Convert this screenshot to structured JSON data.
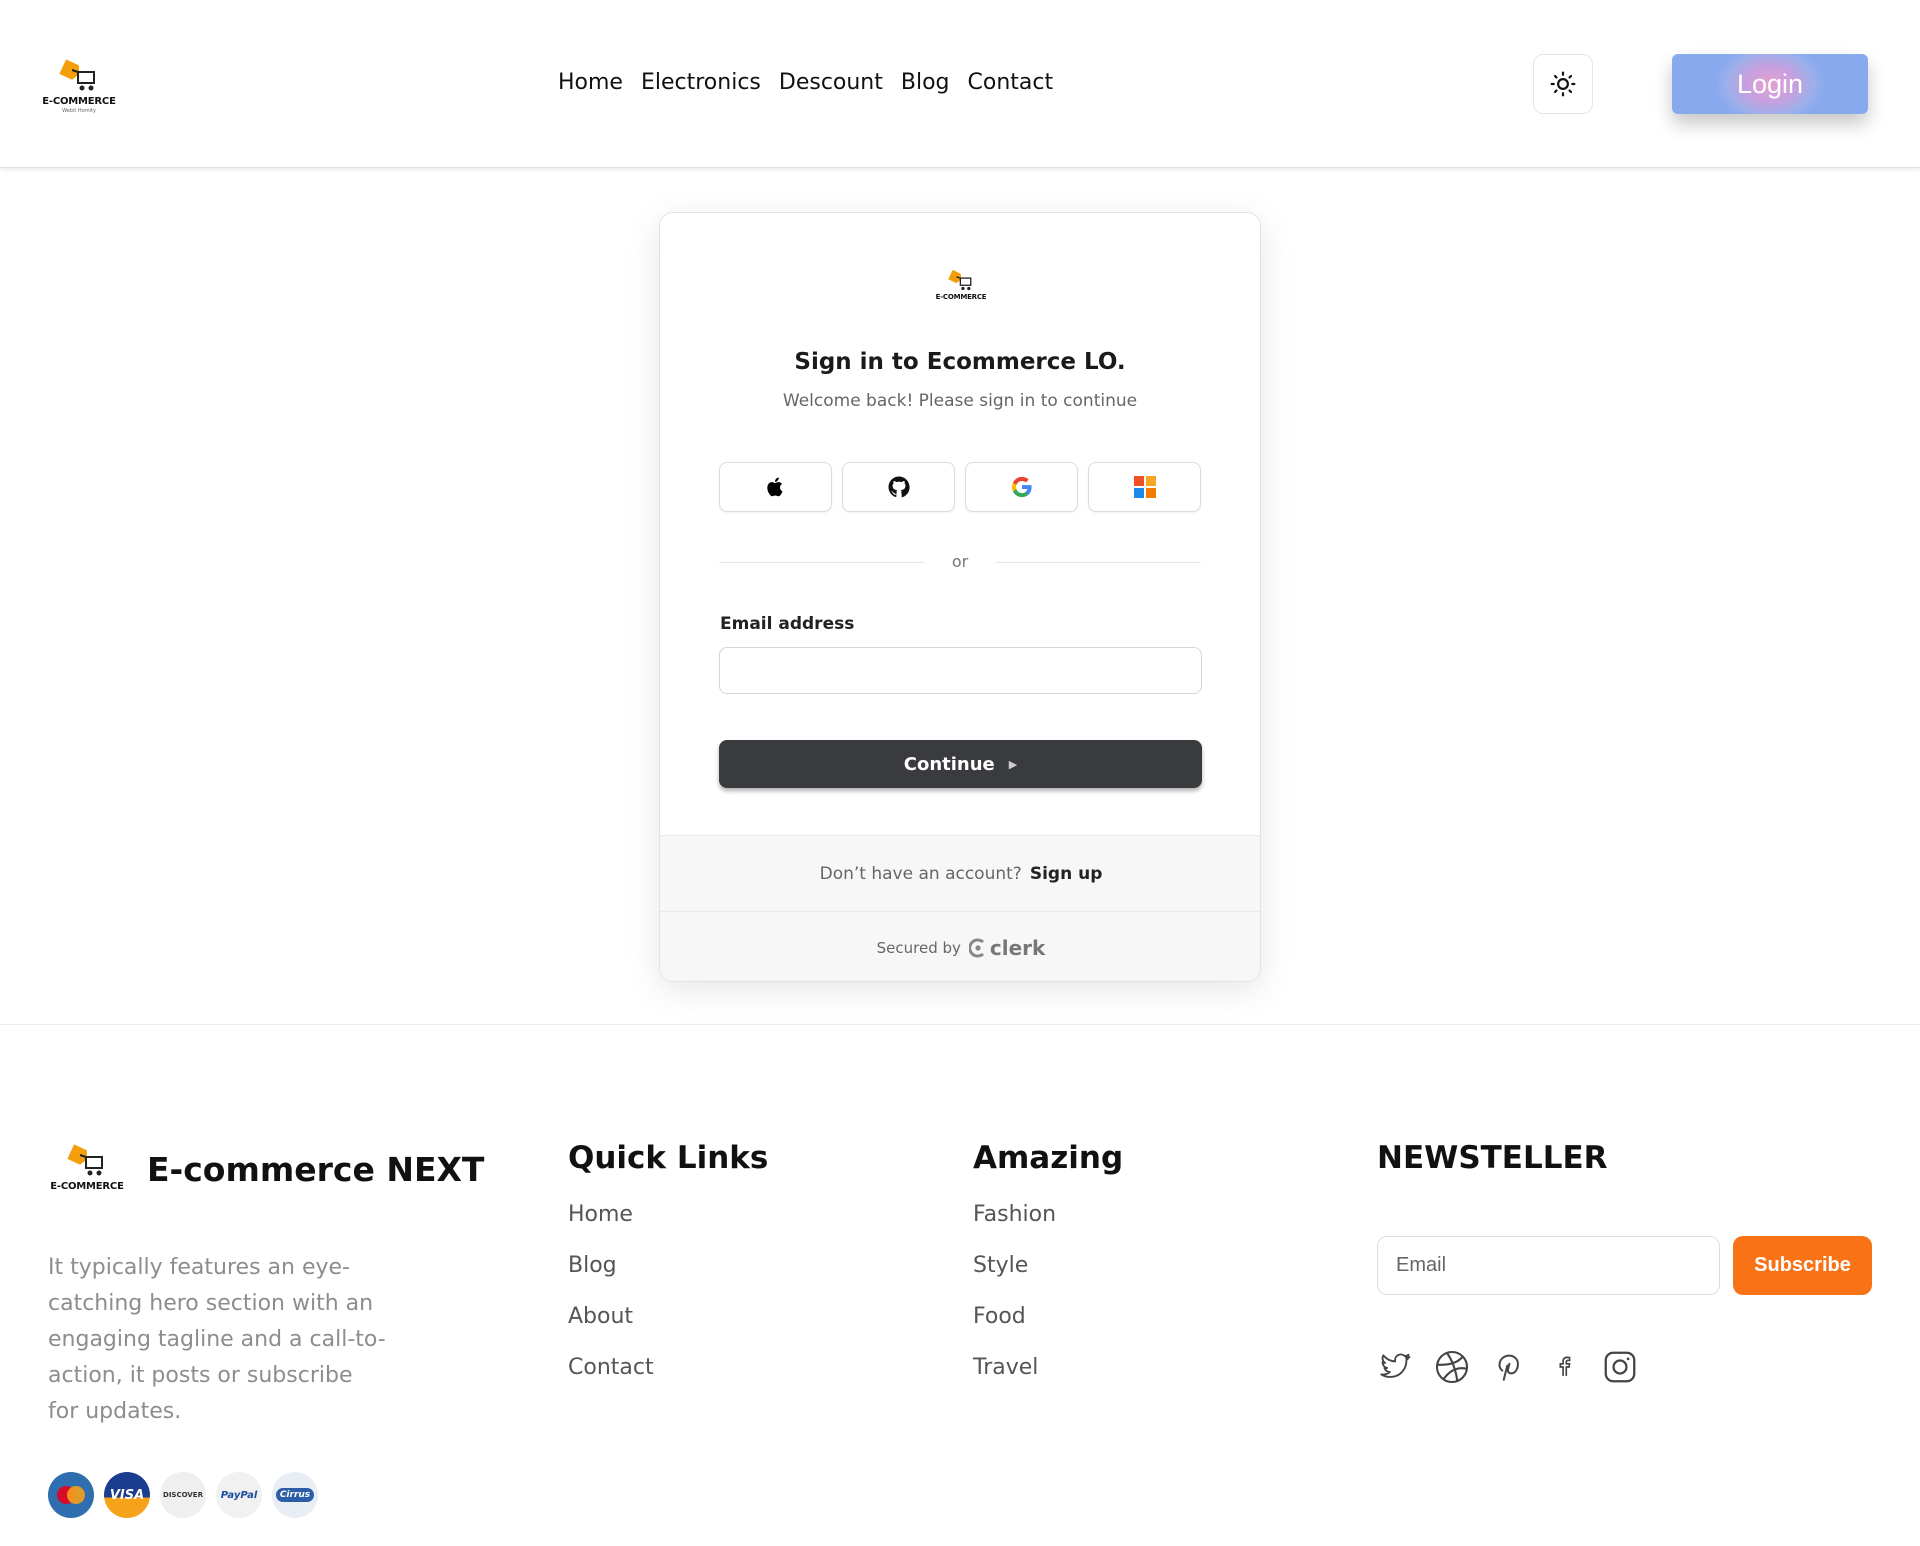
{
  "header": {
    "logo_text": "E-COMMERCE",
    "logo_sub": "Webit Homity",
    "nav": [
      {
        "label": "Home"
      },
      {
        "label": "Electronics"
      },
      {
        "label": "Descount"
      },
      {
        "label": "Blog"
      },
      {
        "label": "Contact"
      }
    ],
    "theme_icon": "sun-icon",
    "login_label": "Login"
  },
  "signin": {
    "logo_text": "E-COMMERCE",
    "title": "Sign in to Ecommerce LO.",
    "subtitle": "Welcome back! Please sign in to continue",
    "providers": [
      "apple-icon",
      "github-icon",
      "google-icon",
      "microsoft-icon"
    ],
    "or_label": "or",
    "email_label": "Email address",
    "email_value": "",
    "continue_label": "Continue",
    "no_account_text": "Don’t have an account?",
    "signup_label": "Sign up",
    "secured_by": "Secured by",
    "clerk_label": "clerk"
  },
  "footer": {
    "logo_text": "E-COMMERCE",
    "brand": "E-commerce NEXT",
    "description": "It typically features an eye-catching hero section with an engaging tagline and a call-to-action, it posts or subscribe for updates.",
    "payments": [
      "MasterCard",
      "VISA",
      "DISCOVER",
      "PayPal",
      "Cirrus"
    ],
    "quick_links": {
      "title": "Quick Links",
      "items": [
        "Home",
        "Blog",
        "About",
        "Contact"
      ]
    },
    "amazing": {
      "title": "Amazing",
      "items": [
        "Fashion",
        "Style",
        "Food",
        "Travel"
      ]
    },
    "newsletter": {
      "title": "NEWSTELLER",
      "placeholder": "Email",
      "subscribe_label": "Subscribe"
    },
    "socials": [
      "twitter-icon",
      "dribbble-icon",
      "pinterest-icon",
      "facebook-icon",
      "instagram-icon"
    ]
  },
  "colors": {
    "accent_orange": "#f97316",
    "continue_bg": "#3a3b3f"
  }
}
